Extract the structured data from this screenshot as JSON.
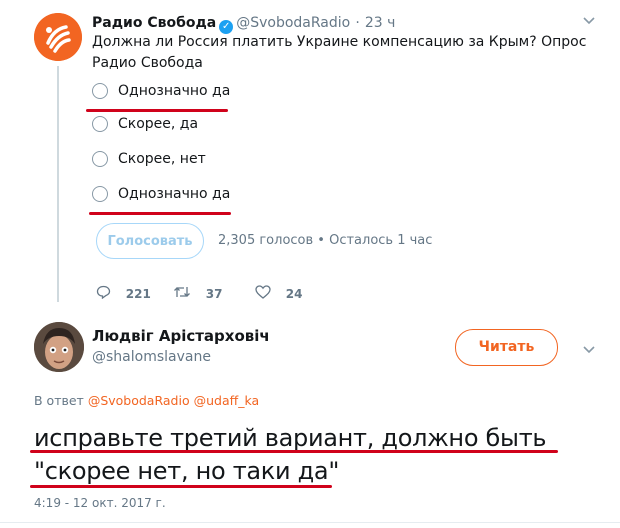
{
  "tweet": {
    "author_name": "Радио Свобода",
    "author_handle": "@SvobodaRadio",
    "separator": "·",
    "time_ago": "23 ч",
    "text": "Должна ли Россия платить Украине компенсацию за Крым? Опрос Радио Свобода",
    "poll": {
      "options": [
        "Однозначно да",
        "Скорее, да",
        "Скорее, нет",
        "Однозначно да"
      ],
      "vote_button": "Голосовать",
      "meta": "2,305 голосов • Осталось 1 час"
    },
    "actions": {
      "replies": "221",
      "retweets": "37",
      "likes": "24"
    }
  },
  "reply": {
    "author_name": "Людвіг Арістарховіч",
    "author_handle": "@shalomslavane",
    "follow_button": "Читать",
    "reply_prefix": "В ответ",
    "mention_1": "@SvobodaRadio",
    "mention_2": "@udaff_ka",
    "text_line_1": "исправьте третий вариант, должно быть",
    "text_line_2": "\"скорее нет, но таки да\"",
    "timestamp": "4:19 - 12 окт. 2017 г."
  },
  "colors": {
    "brand": "#f26522",
    "annotation": "#d0021b",
    "verified": "#1da1f2"
  },
  "icons": [
    "radio-svoboda-logo",
    "verified-badge-icon",
    "chevron-down-icon",
    "reply-icon",
    "retweet-icon",
    "heart-icon",
    "user-avatar"
  ]
}
